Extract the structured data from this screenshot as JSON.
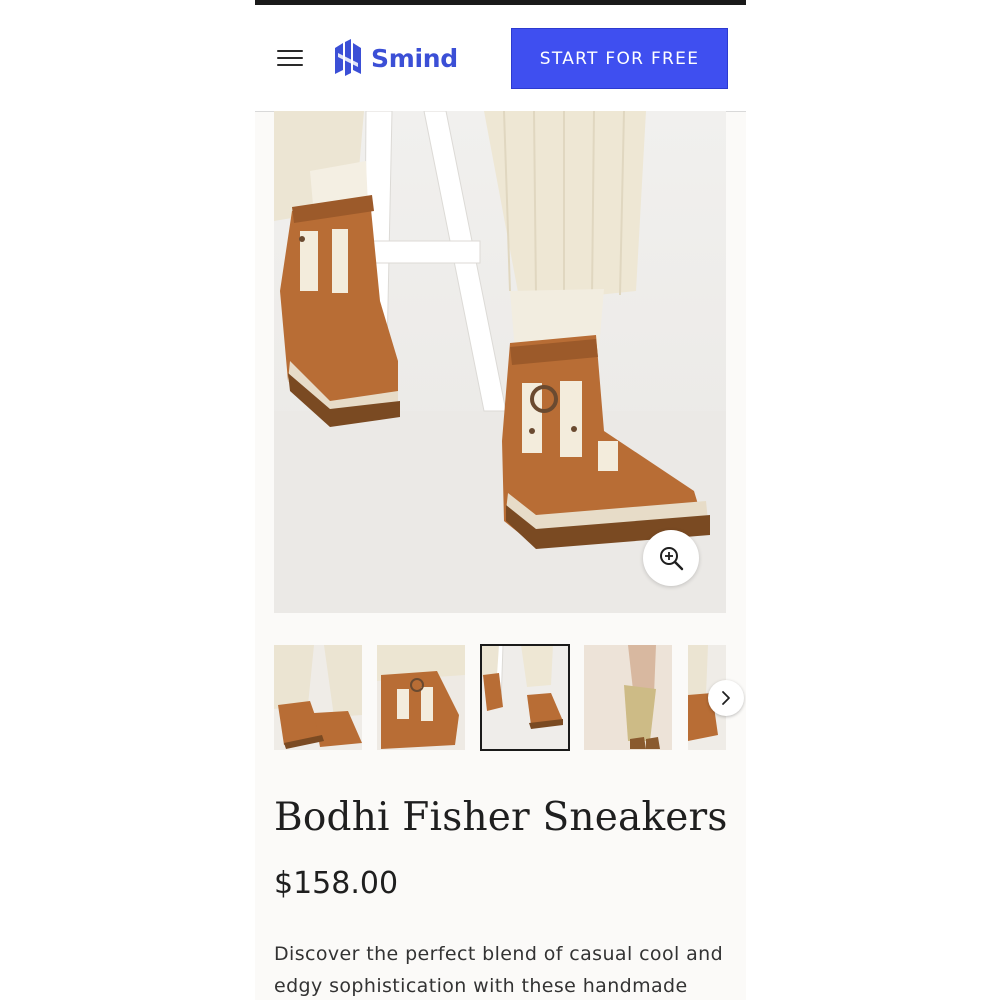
{
  "header": {
    "brand": "Smind",
    "cta_label": "START FOR FREE"
  },
  "gallery": {
    "main_image": "product-photo-tan-suede-fisherman-sneakers-with-cream-socks",
    "thumbnails": [
      {
        "image": "product-thumbnail-1"
      },
      {
        "image": "product-thumbnail-2"
      },
      {
        "image": "product-thumbnail-3",
        "selected": true
      },
      {
        "image": "product-thumbnail-4"
      },
      {
        "image": "product-thumbnail-5"
      }
    ],
    "zoom_icon": "zoom-in-icon",
    "next_icon": "chevron-right-icon"
  },
  "product": {
    "title": "Bodhi Fisher Sneakers",
    "price": "$158.00",
    "description": "Discover the perfect blend of casual cool and edgy sophistication with these handmade high-"
  },
  "colors": {
    "brand": "#3b4fd6",
    "cta_background": "#3f4ff0",
    "suede": "#b86d35",
    "sole": "#7a4a22"
  }
}
